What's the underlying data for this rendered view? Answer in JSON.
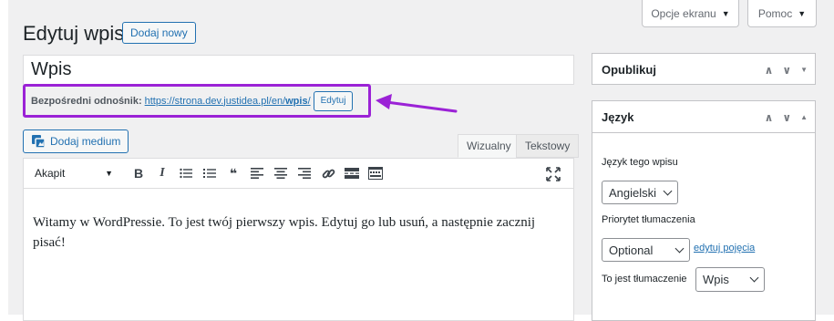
{
  "screen_options": {
    "label": "Opcje ekranu",
    "arrow": "▼"
  },
  "help": {
    "label": "Pomoc",
    "arrow": "▼"
  },
  "header": {
    "title": "Edytuj wpis",
    "add_new": "Dodaj nowy"
  },
  "post": {
    "title": "Wpis"
  },
  "permalink": {
    "label": "Bezpośredni odnośnik:",
    "url_prefix": "https://strona.dev.justidea.pl/en/",
    "slug": "wpis",
    "url_suffix": "/",
    "edit_label": "Edytuj",
    "highlight_color": "#9b22d6"
  },
  "editor": {
    "add_media": "Dodaj medium",
    "tabs": {
      "visual": "Wizualny",
      "text": "Tekstowy"
    },
    "format": "Akapit",
    "format_arrow": "▼",
    "toolbar": {
      "bold": "B",
      "italic": "I",
      "blockquote": "❝"
    },
    "content": "Witamy w WordPressie. To jest twój pierwszy wpis. Edytuj go lub usuń, a następnie zacznij pisać!"
  },
  "sidebar": {
    "publish": {
      "title": "Opublikuj"
    },
    "language": {
      "title": "Język",
      "post_language_label": "Język tego wpisu",
      "post_language_value": "Angielski",
      "priority_label": "Priorytet tłumaczenia",
      "priority_value": "Optional",
      "edit_terms": "edytuj pojęcia",
      "translation_label": "To jest tłumaczenie",
      "translation_value": "Wpis"
    },
    "controls": {
      "up": "∧",
      "down": "∨",
      "collapse": "▼",
      "expand": "▲"
    }
  },
  "colors": {
    "accent": "#2271b1",
    "background": "#f0f0f1"
  }
}
